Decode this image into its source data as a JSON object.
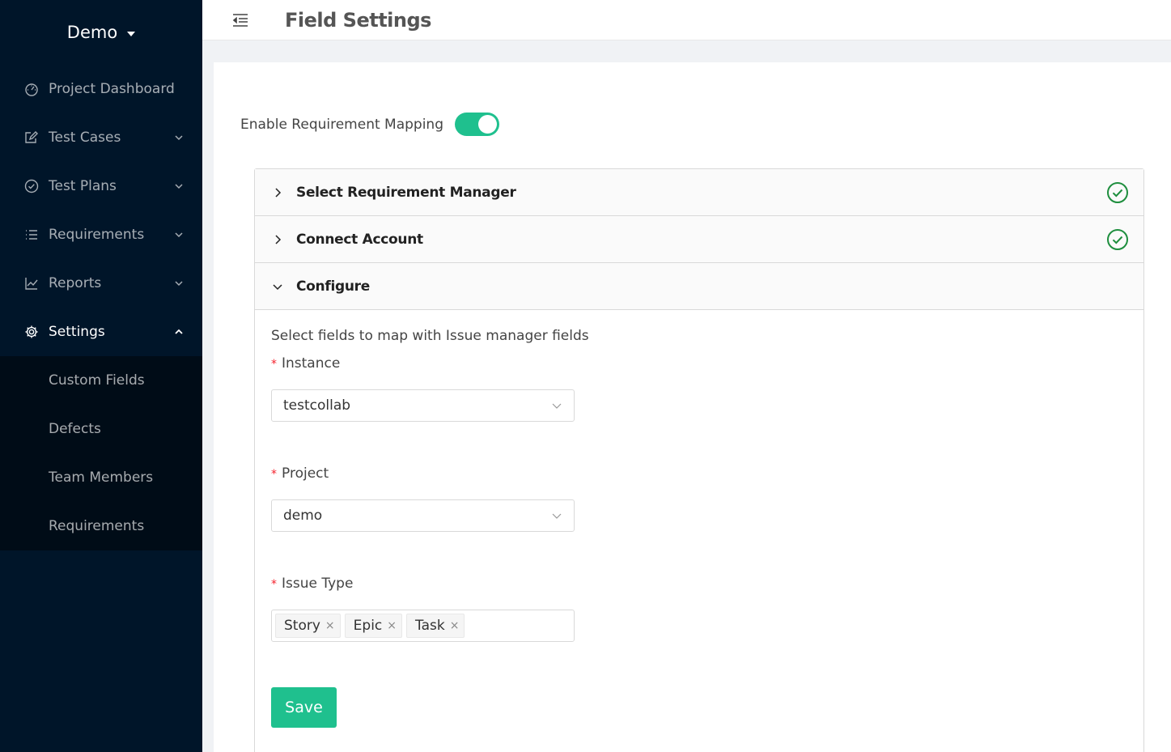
{
  "sidebar": {
    "brand": "Demo",
    "items": [
      {
        "label": "Project Dashboard",
        "icon": "dashboard-icon"
      },
      {
        "label": "Test Cases",
        "icon": "edit-icon"
      },
      {
        "label": "Test Plans",
        "icon": "check-circle-icon"
      },
      {
        "label": "Requirements",
        "icon": "list-icon"
      },
      {
        "label": "Reports",
        "icon": "line-chart-icon"
      },
      {
        "label": "Settings",
        "icon": "gear-icon"
      }
    ],
    "submenu": [
      "Custom Fields",
      "Defects",
      "Team Members",
      "Requirements"
    ]
  },
  "header": {
    "title": "Field Settings"
  },
  "content": {
    "toggle_label": "Enable Requirement Mapping",
    "toggle_on": true,
    "panels": [
      {
        "title": "Select Requirement Manager",
        "done": true
      },
      {
        "title": "Connect Account",
        "done": true
      },
      {
        "title": "Configure",
        "expanded": true
      }
    ],
    "configure": {
      "hint": "Select fields to map with Issue manager fields",
      "required_mark": "*",
      "instance_label": "Instance",
      "instance_value": "testcollab",
      "project_label": "Project",
      "project_value": "demo",
      "issue_type_label": "Issue Type",
      "issue_types": [
        "Story",
        "Epic",
        "Task"
      ],
      "tag_remove": "×",
      "save_label": "Save"
    }
  },
  "colors": {
    "sidebar_bg": "#001529",
    "submenu_bg": "#000c17",
    "accent": "#1fc08e",
    "success": "#1e8e3e"
  }
}
